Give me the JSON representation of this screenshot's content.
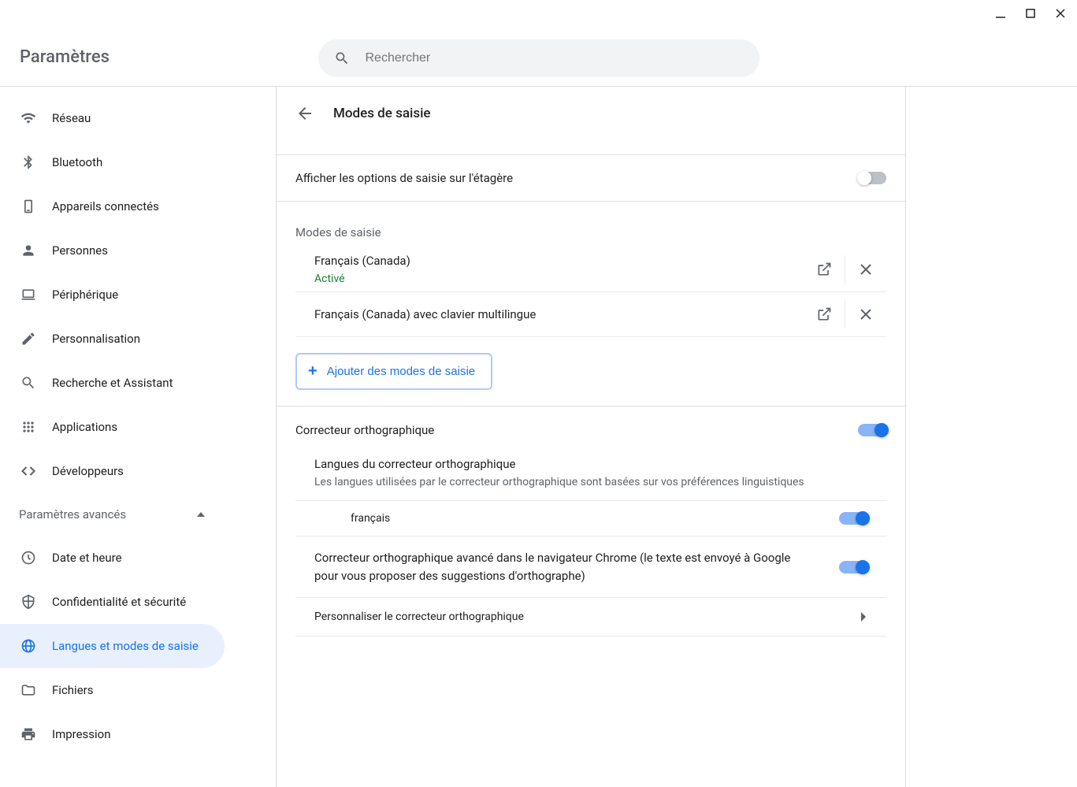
{
  "header": {
    "title": "Paramètres",
    "search_placeholder": "Rechercher"
  },
  "sidebar": {
    "items": [
      {
        "id": "network",
        "label": "Réseau"
      },
      {
        "id": "bluetooth",
        "label": "Bluetooth"
      },
      {
        "id": "devices",
        "label": "Appareils connectés"
      },
      {
        "id": "people",
        "label": "Personnes"
      },
      {
        "id": "device",
        "label": "Périphérique"
      },
      {
        "id": "personalization",
        "label": "Personnalisation"
      },
      {
        "id": "search",
        "label": "Recherche et Assistant"
      },
      {
        "id": "apps",
        "label": "Applications"
      },
      {
        "id": "developers",
        "label": "Développeurs"
      }
    ],
    "advanced_label": "Paramètres avancés",
    "advanced_items": [
      {
        "id": "datetime",
        "label": "Date et heure"
      },
      {
        "id": "privacy",
        "label": "Confidentialité et sécurité"
      },
      {
        "id": "languages",
        "label": "Langues et modes de saisie"
      },
      {
        "id": "files",
        "label": "Fichiers"
      },
      {
        "id": "print",
        "label": "Impression"
      }
    ]
  },
  "page": {
    "title": "Modes de saisie",
    "shelf_option": "Afficher les options de saisie sur l'étagère",
    "section_input_methods": "Modes de saisie",
    "input_methods": [
      {
        "name": "Français (Canada)",
        "status": "Activé"
      },
      {
        "name": "Français (Canada) avec clavier multilingue"
      }
    ],
    "add_button": "Ajouter des modes de saisie",
    "spellcheck": {
      "title": "Correcteur orthographique",
      "langs_title": "Langues du correcteur orthographique",
      "langs_desc": "Les langues utilisées par le correcteur orthographique sont basées sur vos préférences linguistiques",
      "lang_french": "français",
      "enhanced": "Correcteur orthographique avancé dans le navigateur Chrome (le texte est envoyé à Google pour vous proposer des suggestions d'orthographe)",
      "customize": "Personnaliser le correcteur orthographique"
    }
  }
}
